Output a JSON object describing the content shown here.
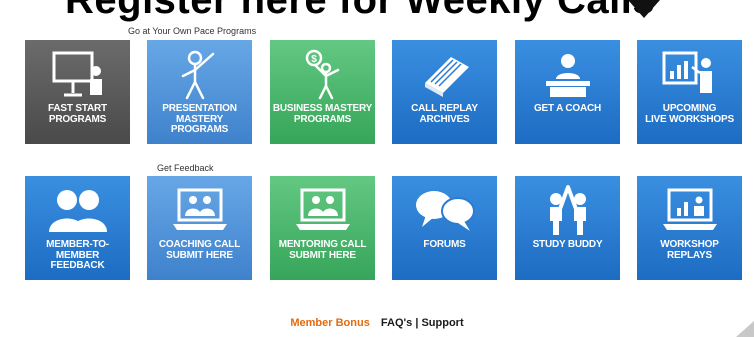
{
  "banner": {
    "text": "Register here for Weekly Calls"
  },
  "sections": [
    {
      "label": "Go at Your Own Pace Programs"
    },
    {
      "label": "Get Feedback"
    }
  ],
  "tiles": [
    {
      "label": "FAST START\nPROGRAMS",
      "icon": "presentation-board-icon",
      "color": "#5a5a5a"
    },
    {
      "label": "PRESENTATION\nMASTERY\nPROGRAMS",
      "icon": "presenter-pointing-icon",
      "color": "#4f91d8"
    },
    {
      "label": "BUSINESS MASTERY\nPROGRAMS",
      "icon": "person-with-dollar-icon",
      "color": "#48b86c"
    },
    {
      "label": "CALL REPLAY\nARCHIVES",
      "icon": "book-icon",
      "color": "#2a7bd2"
    },
    {
      "label": "GET A COACH",
      "icon": "coach-at-desk-icon",
      "color": "#2a7bd2"
    },
    {
      "label": "UPCOMING\nLIVE WORKSHOPS",
      "icon": "presenter-chart-icon",
      "color": "#2a7bd2"
    },
    {
      "label": "MEMBER-TO-MEMBER\nFEEDBACK",
      "icon": "two-people-icon",
      "color": "#2a7bd2"
    },
    {
      "label": "COACHING CALL\nSUBMIT HERE",
      "icon": "laptop-people-icon",
      "color": "#4f91d8"
    },
    {
      "label": "MENTORING CALL\nSUBMIT HERE",
      "icon": "laptop-people-icon",
      "color": "#48b86c"
    },
    {
      "label": "FORUMS",
      "icon": "speech-bubbles-icon",
      "color": "#2a7bd2"
    },
    {
      "label": "STUDY BUDDY",
      "icon": "high-five-icon",
      "color": "#2a7bd2"
    },
    {
      "label": "WORKSHOP\nREPLAYS",
      "icon": "laptop-chart-icon",
      "color": "#2a7bd2"
    }
  ],
  "footer": {
    "bonus": "Member Bonus",
    "faqs": "FAQ's",
    "separator": "|",
    "support": "Support"
  },
  "colors": {
    "bonus_link": "#e36a10",
    "gray_tile": "#5a5a5a",
    "light_blue_tile": "#4f91d8",
    "green_tile": "#48b86c",
    "blue_tile": "#2a7bd2"
  }
}
